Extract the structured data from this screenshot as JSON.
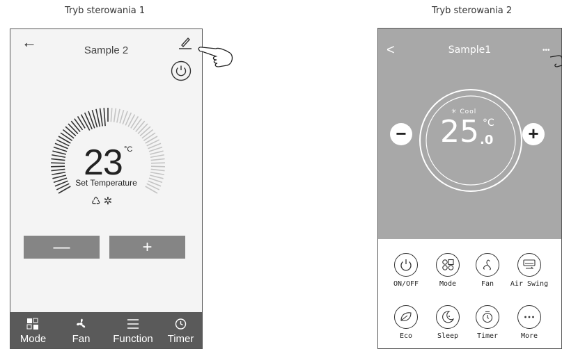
{
  "captions": {
    "left": "Tryb sterowania 1",
    "right": "Tryb sterowania 2"
  },
  "mode1": {
    "title": "Sample 2",
    "temperature": "23",
    "unit": "°C",
    "set_label": "Set Temperature",
    "mode_icons": "♺ ✲",
    "minus_label": "—",
    "plus_label": "+",
    "tabs": [
      {
        "label": "Mode",
        "icon": "mode-icon"
      },
      {
        "label": "Fan",
        "icon": "fan-icon"
      },
      {
        "label": "Function",
        "icon": "menu-icon"
      },
      {
        "label": "Timer",
        "icon": "clock-icon"
      }
    ]
  },
  "mode2": {
    "title": "Sample1",
    "mode_label": "✳ Cool",
    "temperature": "25",
    "unit": "°C",
    "decimal": ".0",
    "minus_label": "−",
    "plus_label": "+",
    "buttons": [
      {
        "label": "ON/OFF",
        "icon": "power-icon"
      },
      {
        "label": "Mode",
        "icon": "mode-icon"
      },
      {
        "label": "Fan",
        "icon": "fan-icon"
      },
      {
        "label": "Air Swing",
        "icon": "air-swing-icon"
      },
      {
        "label": "Eco",
        "icon": "leaf-icon"
      },
      {
        "label": "Sleep",
        "icon": "sleep-icon"
      },
      {
        "label": "Timer",
        "icon": "timer-icon"
      },
      {
        "label": "More",
        "icon": "more-icon"
      }
    ]
  }
}
